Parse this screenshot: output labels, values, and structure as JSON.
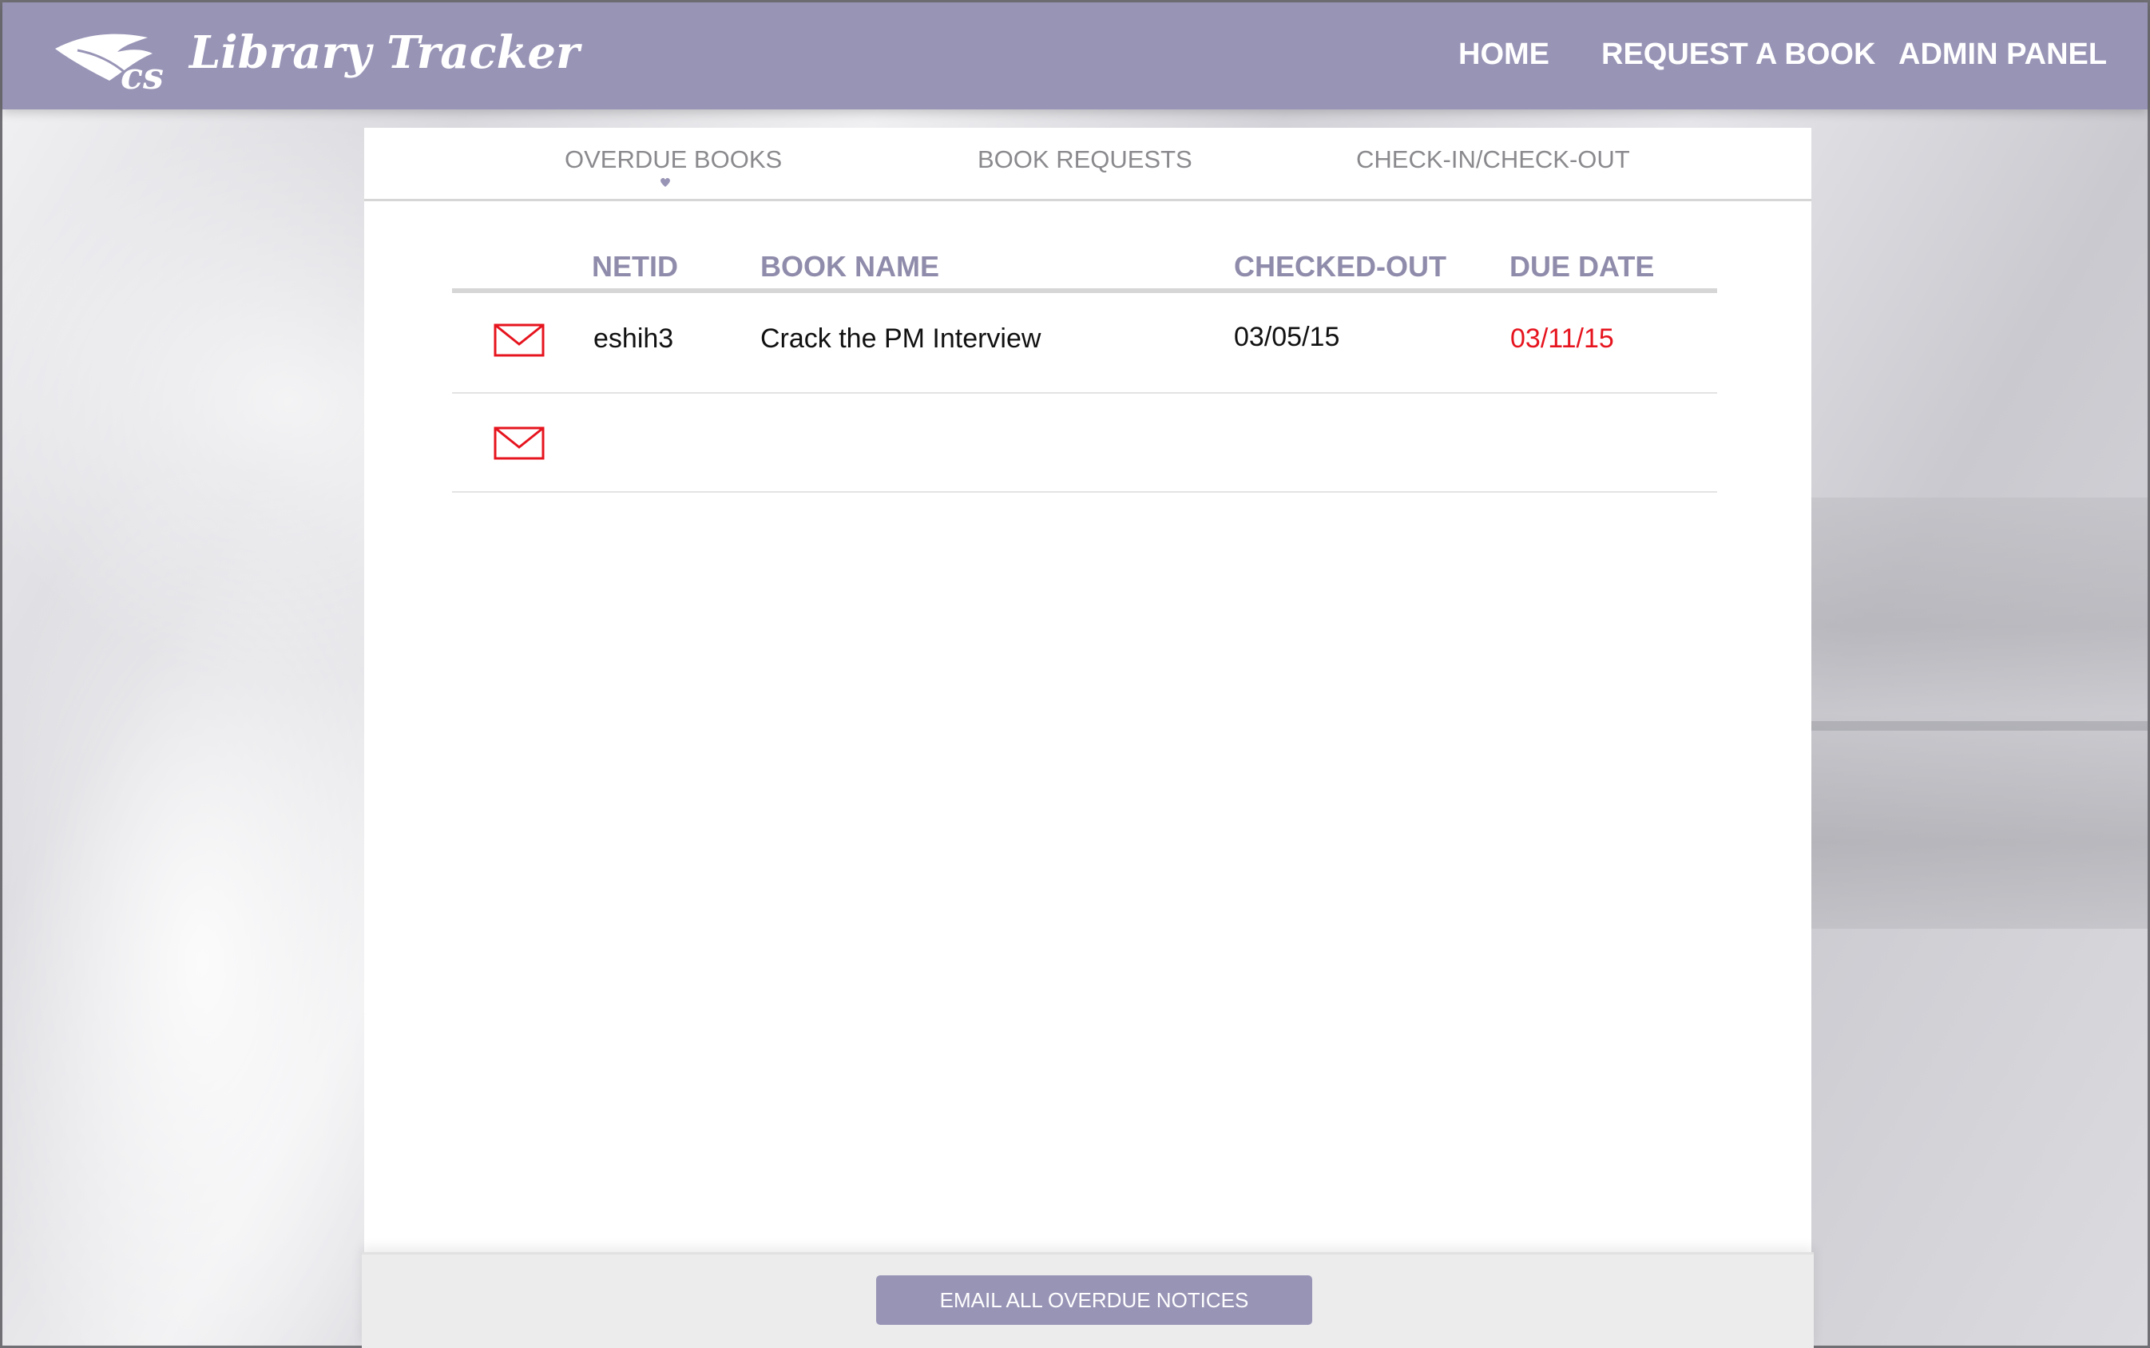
{
  "header": {
    "app_title": "Library Tracker",
    "logo_icon": "cs-quill-logo",
    "nav": {
      "home": "HOME",
      "request": "REQUEST A  BOOK",
      "admin": "ADMIN PANEL"
    }
  },
  "tabs": {
    "overdue": "OVERDUE BOOKS",
    "requests": "BOOK REQUESTS",
    "checkin": "CHECK-IN/CHECK-OUT",
    "active": "overdue"
  },
  "table": {
    "columns": {
      "netid": "NETID",
      "book_name": "BOOK NAME",
      "checked_out": "CHECKED-OUT",
      "due_date": "DUE DATE"
    },
    "rows": [
      {
        "netid": "eshih3",
        "book_name": "Crack the PM Interview",
        "checked_out": "03/05/15",
        "due_date": "03/11/15"
      },
      {
        "netid": "",
        "book_name": "",
        "checked_out": "",
        "due_date": ""
      }
    ]
  },
  "footer": {
    "email_all": "EMAIL ALL OVERDUE NOTICES"
  },
  "colors": {
    "brand": "#9894b6",
    "header_text": "#8f8bab",
    "overdue": "#e6141e",
    "mail_icon": "#e6141e"
  }
}
